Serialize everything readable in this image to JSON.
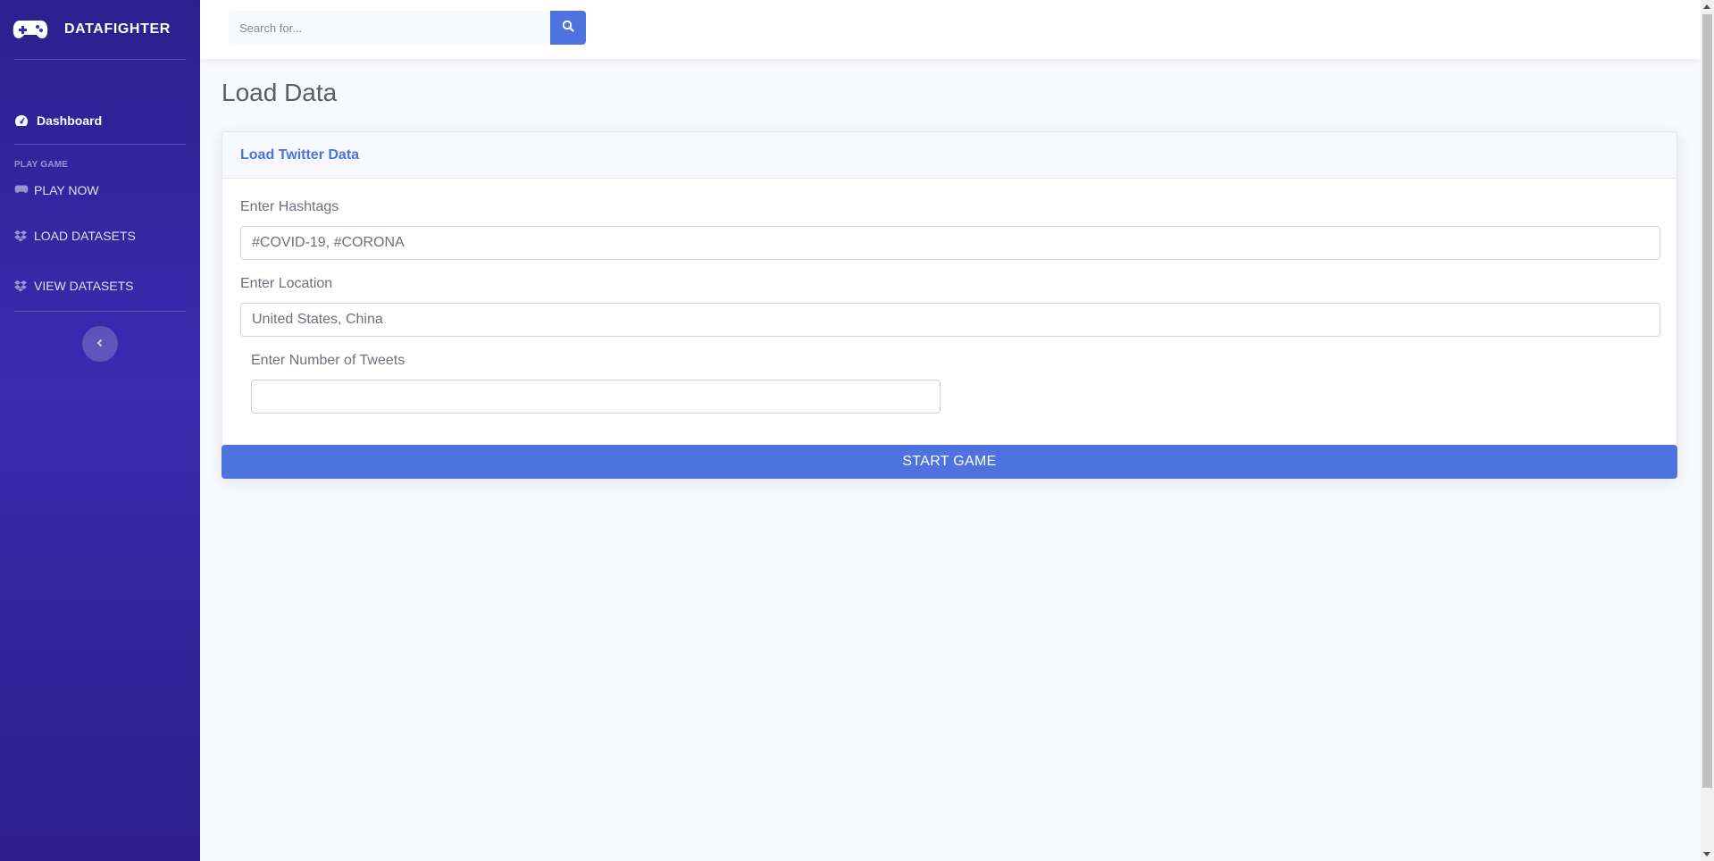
{
  "brand": {
    "name": "DATAFIGHTER",
    "icon": "gamepad-icon"
  },
  "sidebar": {
    "dashboard": {
      "label": "Dashboard",
      "icon": "tachometer-icon"
    },
    "heading": "PLAY GAME",
    "items": [
      {
        "label": "PLAY NOW",
        "icon": "gamepad-icon"
      },
      {
        "label": "LOAD DATASETS",
        "icon": "dropbox-icon"
      },
      {
        "label": "VIEW DATASETS",
        "icon": "dropbox-icon"
      }
    ],
    "toggle_icon": "chevron-left-icon"
  },
  "search": {
    "placeholder": "Search for...",
    "icon": "search-icon"
  },
  "page": {
    "title": "Load Data"
  },
  "card": {
    "title": "Load Twitter Data",
    "hashtags": {
      "label": "Enter Hashtags",
      "placeholder": "#COVID-19, #CORONA",
      "value": ""
    },
    "location": {
      "label": "Enter Location",
      "placeholder": "United States, China",
      "value": ""
    },
    "tweets": {
      "label": "Enter Number of Tweets",
      "placeholder": "",
      "value": ""
    },
    "start_label": "START GAME"
  },
  "colors": {
    "primary": "#4e73df",
    "sidebar": "#3a2bb0",
    "text_muted": "#6e707e"
  }
}
